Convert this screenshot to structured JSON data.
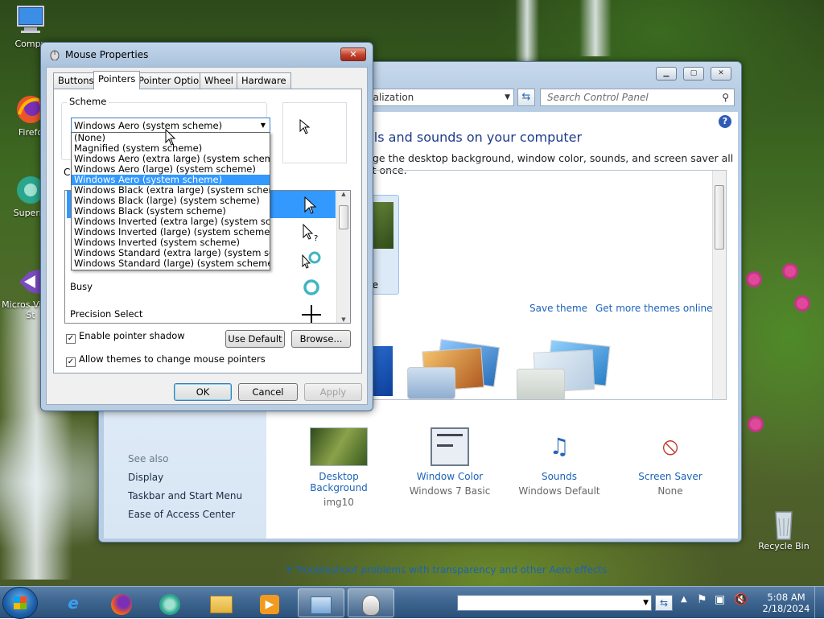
{
  "desktop": {
    "icons": [
      {
        "id": "computer",
        "label": "Compu"
      },
      {
        "id": "firefox",
        "label": "Firefo"
      },
      {
        "id": "supermium",
        "label": "Superm"
      },
      {
        "id": "edge",
        "label": "Micros Visual St"
      },
      {
        "id": "recycle",
        "label": "Recycle Bin"
      }
    ]
  },
  "control_panel": {
    "address": "nalization",
    "search_placeholder": "Search Control Panel",
    "heading": "als and sounds on your computer",
    "subheading": "nge the desktop background, window color, sounds, and screen saver all at once.",
    "theme_tile_label": "ne",
    "save_theme": "Save theme",
    "get_more": "Get more themes online",
    "see_also": "See also",
    "left_links": [
      "Display",
      "Taskbar and Start Menu",
      "Ease of Access Center"
    ],
    "items": [
      {
        "id": "desktop-background",
        "label": "Desktop Background",
        "value": "img10"
      },
      {
        "id": "window-color",
        "label": "Window Color",
        "value": "Windows 7 Basic"
      },
      {
        "id": "sounds",
        "label": "Sounds",
        "value": "Windows Default"
      },
      {
        "id": "screen-saver",
        "label": "Screen Saver",
        "value": "None"
      }
    ],
    "troubleshoot": "Troubleshoot problems with transparency and other Aero effects"
  },
  "mouse_properties": {
    "title": "Mouse Properties",
    "tabs": [
      "Buttons",
      "Pointers",
      "Pointer Options",
      "Wheel",
      "Hardware"
    ],
    "active_tab": "Pointers",
    "scheme_label": "Scheme",
    "scheme_value": "Windows Aero (system scheme)",
    "scheme_options": [
      "(None)",
      "Magnified (system scheme)",
      "Windows Aero (extra large) (system scheme)",
      "Windows Aero (large) (system scheme)",
      "Windows Aero (system scheme)",
      "Windows Black (extra large) (system scheme)",
      "Windows Black (large) (system scheme)",
      "Windows Black (system scheme)",
      "Windows Inverted (extra large) (system scheme)",
      "Windows Inverted (large) (system scheme)",
      "Windows Inverted (system scheme)",
      "Windows Standard (extra large) (system scheme)",
      "Windows Standard (large) (system scheme)"
    ],
    "selected_option_index": 4,
    "customize_label_partial": "C",
    "cursor_rows": [
      {
        "label": "",
        "icon": "arrow"
      },
      {
        "label": "",
        "icon": "help-select"
      },
      {
        "label": "",
        "icon": "working-in-background"
      },
      {
        "label": "Busy",
        "icon": "busy"
      },
      {
        "label": "Precision Select",
        "icon": "crosshair"
      }
    ],
    "enable_shadow": "Enable pointer shadow",
    "allow_themes": "Allow themes to change mouse pointers",
    "use_default": "Use Default",
    "browse": "Browse...",
    "ok": "OK",
    "cancel": "Cancel",
    "apply": "Apply"
  },
  "taskbar": {
    "clock_time": "5:08 AM",
    "clock_date": "2/18/2024"
  }
}
